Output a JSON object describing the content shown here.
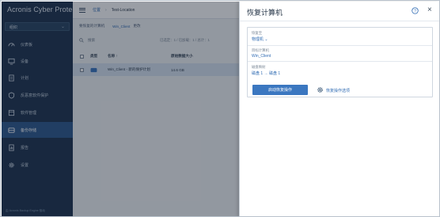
{
  "app": {
    "brand": "Acronis",
    "brand_suffix": "Cyber Protect",
    "org_selector": "组织",
    "footer": "由 Acronis Backup Engine 驱动"
  },
  "sidebar": {
    "items": [
      {
        "label": "仪表板",
        "icon": "dashboard-icon"
      },
      {
        "label": "设备",
        "icon": "monitor-icon"
      },
      {
        "label": "计划",
        "icon": "plan-icon"
      },
      {
        "label": "反恶意软件保护",
        "icon": "shield-icon"
      },
      {
        "label": "软件管理",
        "icon": "software-icon"
      },
      {
        "label": "备份存储",
        "icon": "storage-icon"
      },
      {
        "label": "报告",
        "icon": "report-icon"
      },
      {
        "label": "设置",
        "icon": "gear-icon"
      }
    ],
    "active_index": 5
  },
  "main": {
    "breadcrumb": {
      "root": "位置",
      "current": "Test-Location"
    },
    "subbar": {
      "back": "要恢复的计算机",
      "machine": "Win_Client",
      "extra": "更改"
    },
    "search": {
      "placeholder": "搜索",
      "status": "已选定：1 / 已加载：1 / 总计：1"
    },
    "table": {
      "headers": [
        "类型",
        "名称 ↑",
        "原始数据大小"
      ],
      "rows": [
        {
          "name": "Win_Client - 新的保护计划",
          "size": "14.6 GB"
        }
      ]
    }
  },
  "panel": {
    "title": "恢复计算机",
    "restore_to_label": "恢复至",
    "restore_to_value": "物理机 ⌄",
    "target_label": "目标计算机",
    "target_value": "Win_Client",
    "mapping_label": "磁盘映射",
    "mapping_value": "磁盘 1 → 磁盘 1",
    "start_button": "启动恢复操作",
    "options_link": "恢复操作选项"
  }
}
